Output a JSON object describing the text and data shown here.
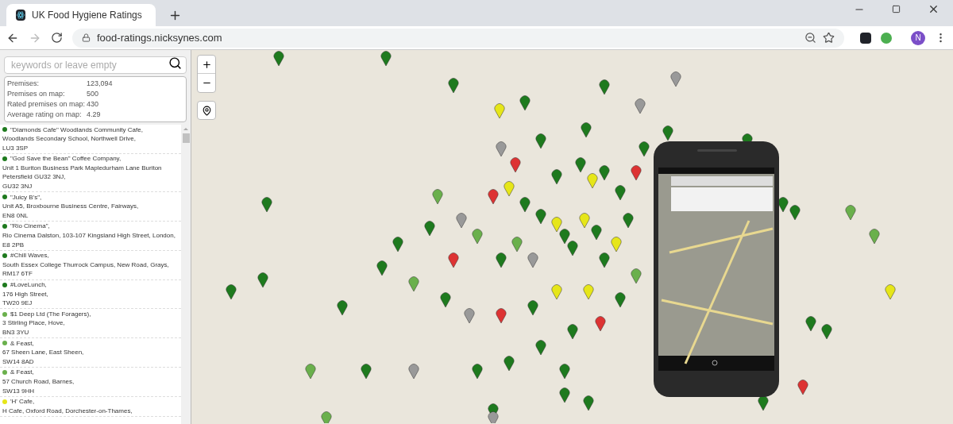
{
  "browser": {
    "tab_title": "UK Food Hygiene Ratings",
    "url": "food-ratings.nicksynes.com",
    "profile_initial": "N"
  },
  "search": {
    "placeholder": "keywords or leave empty"
  },
  "stats": [
    {
      "label": "Premises:",
      "value": "123,094"
    },
    {
      "label": "Premises on map:",
      "value": "500"
    },
    {
      "label": "Rated premises on map:",
      "value": "430"
    },
    {
      "label": "Average rating on map:",
      "value": "4.29"
    }
  ],
  "results": [
    {
      "color": "#1e7a1e",
      "lines": [
        "\"Diamonds Cafe\" Woodlands Community Cafe,",
        "Woodlands Secondary School, Northwell Drive,",
        "LU3 3SP"
      ]
    },
    {
      "color": "#1e7a1e",
      "lines": [
        "\"God Save the Bean\" Coffee Company,",
        "Unit 1 Buriton Business Park Mapledurham Lane Buriton",
        "Petersfield GU32 3NJ,",
        "GU32 3NJ"
      ]
    },
    {
      "color": "#1e7a1e",
      "lines": [
        "\"Juicy B's\",",
        "Unit A5, Broxbourne Business Centre, Fairways,",
        "EN8 0NL"
      ]
    },
    {
      "color": "#1e7a1e",
      "lines": [
        "\"Rio Cinema\",",
        "Rio Cinema Dalston, 103-107 Kingsland High Street, London,",
        "E8 2PB"
      ]
    },
    {
      "color": "#1e7a1e",
      "lines": [
        "#Chill Waves,",
        "South Essex College Thurrock Campus, New Road, Grays,",
        "RM17 6TF"
      ]
    },
    {
      "color": "#1e7a1e",
      "lines": [
        "#LoveLunch,",
        "176 High Street,",
        "TW20 9EJ"
      ]
    },
    {
      "color": "#6ab04c",
      "lines": [
        "$1 Deep Ltd (The Foragers),",
        "3 Stirling Place, Hove,",
        "BN3 3YU"
      ]
    },
    {
      "color": "#6ab04c",
      "lines": [
        "& Feast,",
        "67 Sheen Lane, East Sheen,",
        "SW14 8AD"
      ]
    },
    {
      "color": "#6ab04c",
      "lines": [
        "& Feast,",
        "57 Church Road, Barnes,",
        "SW13 9HH"
      ]
    },
    {
      "color": "#e6e619",
      "lines": [
        "'H' Cafe,",
        "H Cafe, Oxford Road, Dorchester-on-Thames,"
      ]
    }
  ]
}
